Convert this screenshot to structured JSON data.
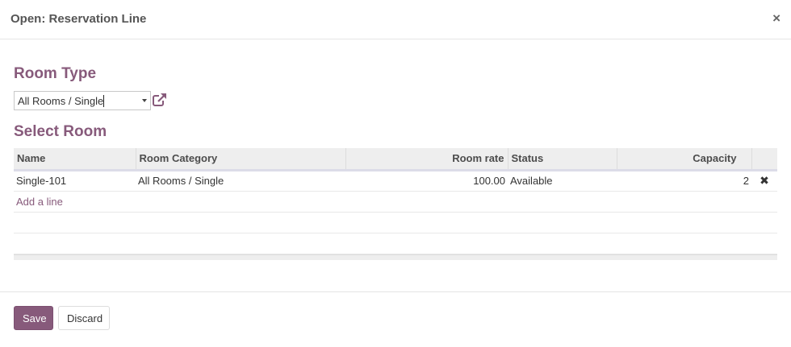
{
  "dialog": {
    "title": "Open: Reservation Line",
    "close_symbol": "×"
  },
  "room_type": {
    "heading": "Room Type",
    "selected_value": "All Rooms / Single"
  },
  "select_room": {
    "heading": "Select Room",
    "columns": [
      "Name",
      "Room Category",
      "Room rate",
      "Status",
      "Capacity"
    ],
    "rows": [
      {
        "name": "Single-101",
        "category": "All Rooms / Single",
        "rate": "100.00",
        "status": "Available",
        "capacity": "2",
        "delete_symbol": "✖"
      }
    ],
    "add_line_label": "Add a line"
  },
  "footer": {
    "save_label": "Save",
    "discard_label": "Discard"
  },
  "colors": {
    "accent": "#875a7b",
    "header_bg": "#eeeeee"
  },
  "icons": [
    "close-icon",
    "dropdown-arrow-icon",
    "external-link-icon",
    "delete-icon"
  ]
}
